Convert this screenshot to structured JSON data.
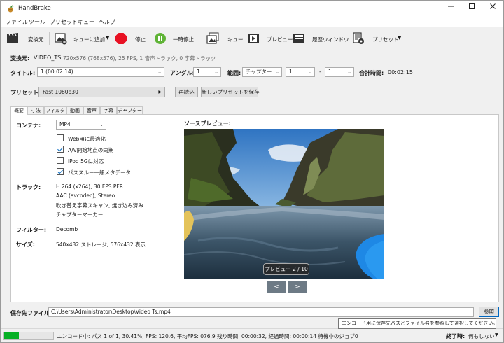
{
  "window": {
    "title": "HandBrake"
  },
  "menu": [
    "ファイル",
    "ツール",
    "プリセット",
    "キュー",
    "ヘルプ"
  ],
  "toolbar": {
    "source": "変換元",
    "add_queue": "キューに追加",
    "stop": "停止",
    "pause": "一時停止",
    "queue": "キュー",
    "preview": "プレビュー",
    "activity": "履歴ウィンドウ",
    "presets": "プリセット"
  },
  "source": {
    "label": "変換元:",
    "name": "VIDEO_TS",
    "info": "720x576 (768x576), 25 FPS, 1 音声トラック, 0 字幕トラック"
  },
  "title_row": {
    "title_label": "タイトル:",
    "title_value": "1 (00:02:14)",
    "angle_label": "アングル:",
    "angle_value": "1",
    "range_label": "範囲:",
    "range_type": "チャプター",
    "range_start": "1",
    "range_dash": "-",
    "range_end": "1",
    "duration_label": "合計時間:",
    "duration_value": "00:02:15"
  },
  "preset_row": {
    "label": "プリセット:",
    "value": "Fast 1080p30",
    "reload": "再読込",
    "save_new": "新しいプリセットを保存"
  },
  "tabs": [
    "概要",
    "寸法",
    "フィルタ",
    "動画",
    "音声",
    "字幕",
    "チャプター"
  ],
  "summary": {
    "container_label": "コンテナ:",
    "container_value": "MP4",
    "options": [
      {
        "label": "Web用に最適化",
        "checked": false
      },
      {
        "label": "A/V開始地点の同期",
        "checked": true
      },
      {
        "label": "iPod 5Gに対応",
        "checked": false
      },
      {
        "label": "パススルー一般メタデータ",
        "checked": true
      }
    ],
    "tracks_label": "トラック:",
    "tracks": [
      "H.264 (x264), 30 FPS PFR",
      "AAC (avcodec), Stereo",
      "吹き替え字幕スキャン, 焼き込み済み",
      "チャプターマーカー"
    ],
    "filters_label": "フィルター:",
    "filters_value": "Decomb",
    "size_label": "サイズ:",
    "size_value": "540x432 ストレージ, 576x432 表示"
  },
  "preview": {
    "label": "ソースプレビュー:",
    "counter": "プレビュー 2 / 10",
    "prev": "<",
    "next": ">"
  },
  "destination": {
    "label": "保存先ファイル:",
    "path": "C:\\Users\\Administrator\\Desktop\\Video Ts.mp4",
    "browse": "参照",
    "tooltip": "エンコード用に保存先パスとファイル名を参照して選択してください。"
  },
  "status": {
    "progress": 0.3041,
    "text": "エンコード中: パス 1 of 1,  30.41%, FPS: 120.6,  平均FPS: 076.9 残り時間: 00:00:32,  経過時間: 00:00:14   待機中のジョブ0",
    "when_done_label": "終了時:",
    "when_done_value": "何もしない"
  },
  "colors": {
    "accent": "#0067c0",
    "stop": "#e81123",
    "pause": "#5fb336",
    "progress": "#06b025"
  }
}
